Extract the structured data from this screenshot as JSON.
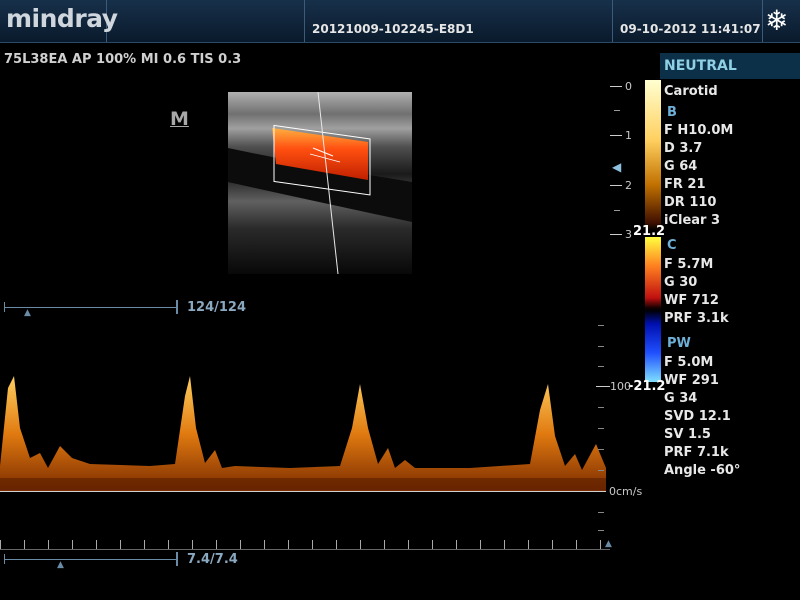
{
  "header": {
    "logo": "mindray",
    "study_id": "20121009-102245-E8D1",
    "datetime": "09-10-2012  11:41:07",
    "freeze_icon": "snowflake-icon"
  },
  "probe_info": "75L38EA  AP 100%  MI 0.6  TIS 0.3",
  "m_marker": "M",
  "depth_scale": [
    "0",
    "1",
    "2",
    "3"
  ],
  "doppler_scale": {
    "top": "100",
    "baseline": "0cm/s"
  },
  "color_scale": {
    "top": "21.2",
    "bottom": "-21.2"
  },
  "panel": {
    "preset": "NEUTRAL",
    "exam": "Carotid",
    "b_head": "B",
    "b_params": [
      "F H10.0M",
      "D 3.7",
      "G 64",
      "FR 21",
      "DR 110",
      "iClear 3"
    ],
    "c_head": "C",
    "c_params": [
      "F 5.7M",
      "G 30",
      "WF 712",
      "PRF 3.1k"
    ],
    "pw_head": "PW",
    "pw_params": [
      "F 5.0M",
      "WF 291",
      "G 34",
      "SVD 12.1",
      "SV 1.5",
      "PRF 7.1k",
      "Angle -60°"
    ]
  },
  "sliders": {
    "image_frame": "124/124",
    "doppler_time": "7.4/7.4"
  }
}
